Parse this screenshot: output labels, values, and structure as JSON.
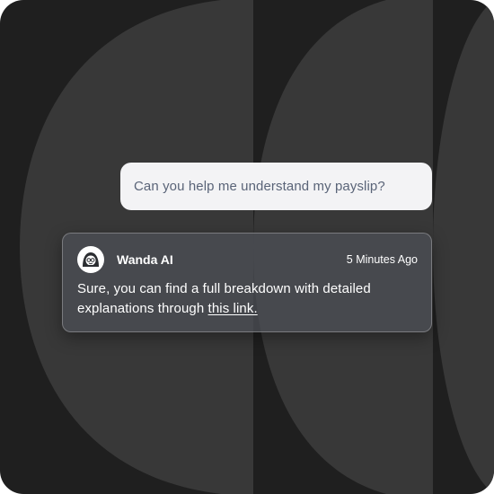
{
  "colors": {
    "background": "#1f1f1f",
    "arc_fill": "#383838",
    "user_bubble": "#f3f3f5",
    "user_text": "#5a6478",
    "ai_card": "#4e5158",
    "ai_text": "#ffffff"
  },
  "user_message": {
    "text": "Can you help me understand my payslip?"
  },
  "ai_message": {
    "avatar_icon": "wanda-avatar-icon",
    "sender": "Wanda AI",
    "timestamp": "5 Minutes Ago",
    "body_prefix": "Sure, you can find a full breakdown with detailed explanations through ",
    "link_text": "this link."
  }
}
